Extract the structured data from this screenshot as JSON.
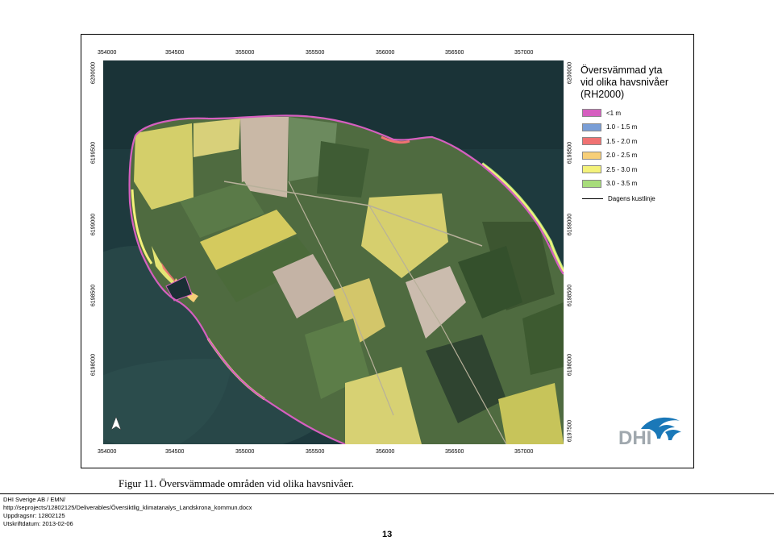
{
  "map": {
    "x_ticks": [
      "354000",
      "354500",
      "355000",
      "355500",
      "356000",
      "356500",
      "357000"
    ],
    "y_ticks": [
      "6200000",
      "6199500",
      "6199000",
      "6198500",
      "6198000",
      "6197500"
    ],
    "y_ticks_left": [
      "6200000",
      "6199500",
      "6199000",
      "6198500",
      "6198000"
    ],
    "y_ticks_right": [
      "6200000",
      "6199500",
      "6199000",
      "6198500",
      "6198000",
      "6197500"
    ],
    "north_arrow_icon": "north-arrow-icon"
  },
  "legend": {
    "title_lines": [
      "Översvämmad yta",
      "vid olika havsnivåer",
      "(RH2000)"
    ],
    "items": [
      {
        "label": "<1 m",
        "color": "#d65fc0"
      },
      {
        "label": "1.0 - 1.5 m",
        "color": "#7a9ed6"
      },
      {
        "label": "1.5 - 2.0 m",
        "color": "#f07272"
      },
      {
        "label": "2.0 - 2.5 m",
        "color": "#f7cf78"
      },
      {
        "label": "2.5 - 3.0 m",
        "color": "#f4f27a"
      },
      {
        "label": "3.0 - 3.5 m",
        "color": "#a7dc7a"
      }
    ],
    "coastline_label": "Dagens kustlinje"
  },
  "logo": {
    "text": "DHI",
    "color": "#1a78b8"
  },
  "caption": "Figur 11. Översvämmade områden vid olika havsnivåer.",
  "footer": {
    "lines": [
      "DHI Sverige AB / EMN/",
      "http://seprojects/12802125/Deliverables/Översiktlig_klimatanalys_Landskrona_kommun.docx",
      "Uppdragsnr: 12802125",
      "Utskriftdatum: 2013-02-06"
    ],
    "page_number": "13"
  }
}
